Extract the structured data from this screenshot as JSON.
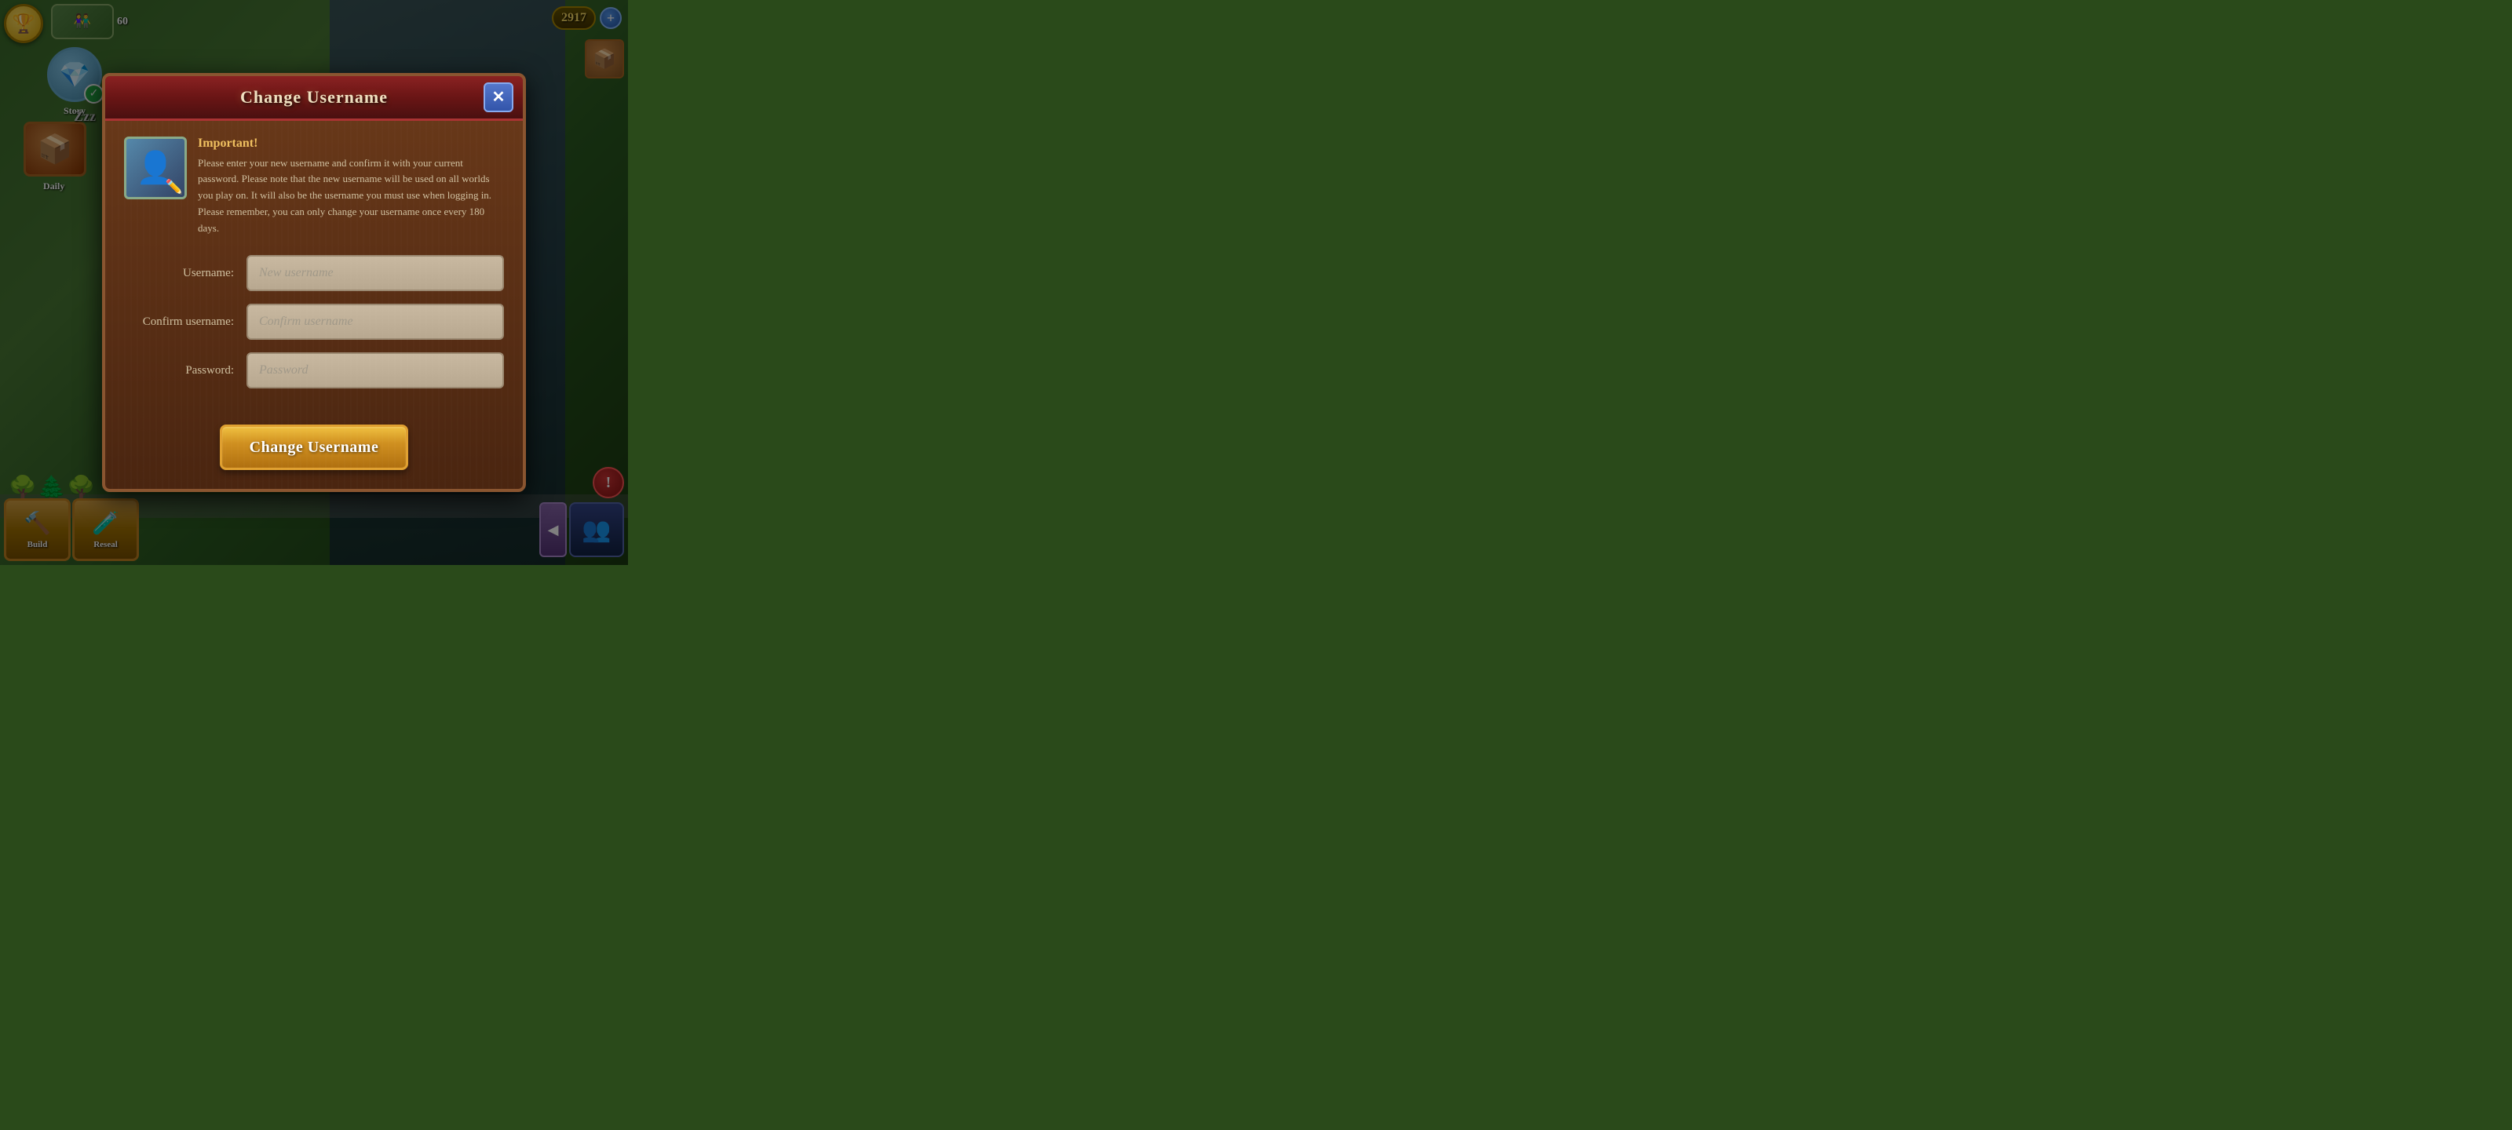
{
  "game": {
    "currency": "2917",
    "add_button_label": "+",
    "story_label": "Story",
    "daily_label": "Daily",
    "build_label": "Build",
    "research_label": "Reseal",
    "player_count": "60",
    "zzz_text": "Zzz",
    "alert_label": "!"
  },
  "modal": {
    "title": "Change Username",
    "close_label": "✕",
    "info_important": "Important!",
    "info_description": "Please enter your new username and confirm it with your current password. Please note that the new username will be used on all worlds you play on. It will also be the username you must use when logging in. Please remember, you can only change your username once every 180 days.",
    "form": {
      "username_label": "Username:",
      "username_placeholder": "New username",
      "confirm_label": "Confirm username:",
      "confirm_placeholder": "Confirm username",
      "password_label": "Password:",
      "password_placeholder": "Password"
    },
    "submit_label": "Change Username"
  }
}
